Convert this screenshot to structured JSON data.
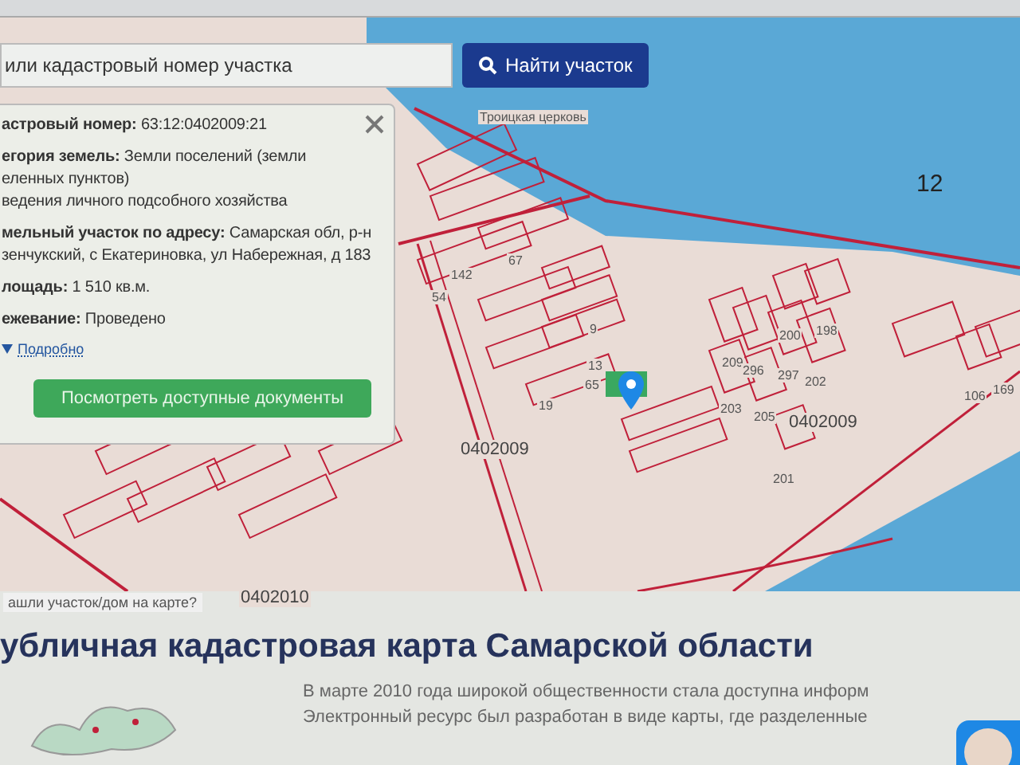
{
  "search": {
    "value": "или кадастровый номер участка",
    "button": "Найти участок"
  },
  "map": {
    "labels": [
      "Троицкая церковь",
      "12",
      "0402009",
      "0402009",
      "0402010",
      "142",
      "67",
      "54",
      "9",
      "13",
      "65",
      "19",
      "209",
      "296",
      "297",
      "202",
      "200",
      "198",
      "203",
      "205",
      "201",
      "169",
      "106"
    ],
    "hint": "ашли участок/дом на карте?"
  },
  "popup": {
    "fields": [
      {
        "lines": [
          "**астровый номер:** 63:12:0402009:21"
        ]
      },
      {
        "lines": [
          "**егория земель:** Земли поселений (земли",
          "еленных пунктов)",
          "ведения личного подсобного хозяйства"
        ]
      },
      {
        "lines": [
          "**мельный участок по адресу:** Самарская обл, р-н",
          "зенчукский, с Екатериновка, ул Набережная, д 183"
        ]
      },
      {
        "lines": [
          "**лощадь:** 1 510 кв.м."
        ]
      },
      {
        "lines": [
          "**ежевание:** Проведено"
        ]
      }
    ],
    "more_link": "Подробно",
    "expanded": false,
    "button": "Посмотреть доступные документы"
  },
  "article": {
    "heading": "убличная кадастровая карта Самарской области",
    "lines": [
      "В марте 2010 года широкой общественности стала доступна информ",
      "Электронный ресурс был разработан в виде карты, где разделенные"
    ]
  }
}
